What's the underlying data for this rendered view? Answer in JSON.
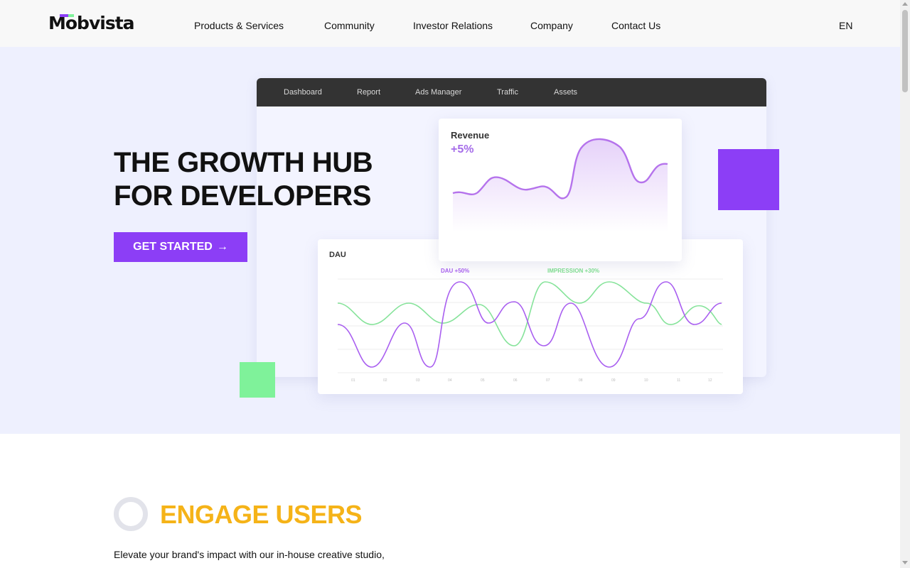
{
  "header": {
    "logo": "Mobvista",
    "nav": [
      "Products & Services",
      "Community",
      "Investor Relations",
      "Company",
      "Contact Us"
    ],
    "language": "EN"
  },
  "hero": {
    "title_line1": "THE GROWTH HUB",
    "title_line2": "FOR DEVELOPERS",
    "cta_label": "GET STARTED",
    "cta_arrow": "→"
  },
  "dashboard": {
    "tabs": [
      "Dashboard",
      "Report",
      "Ads Manager",
      "Traffic",
      "Assets"
    ],
    "revenue": {
      "label": "Revenue",
      "change": "+5%"
    },
    "dau": {
      "label": "DAU",
      "legend_dau": "DAU +50%",
      "legend_impression": "IMPRESSION +30%",
      "x_ticks": [
        "01",
        "02",
        "03",
        "04",
        "05",
        "06",
        "07",
        "08",
        "09",
        "10",
        "11",
        "12"
      ]
    }
  },
  "engage": {
    "title": "ENGAGE USERS",
    "text": "Elevate your brand's impact with our in-house creative studio,"
  },
  "colors": {
    "brand_purple": "#8c3ef6",
    "accent_green": "#7ff29a",
    "engage_yellow": "#f5b318",
    "hero_bg": "#eef0fe"
  }
}
